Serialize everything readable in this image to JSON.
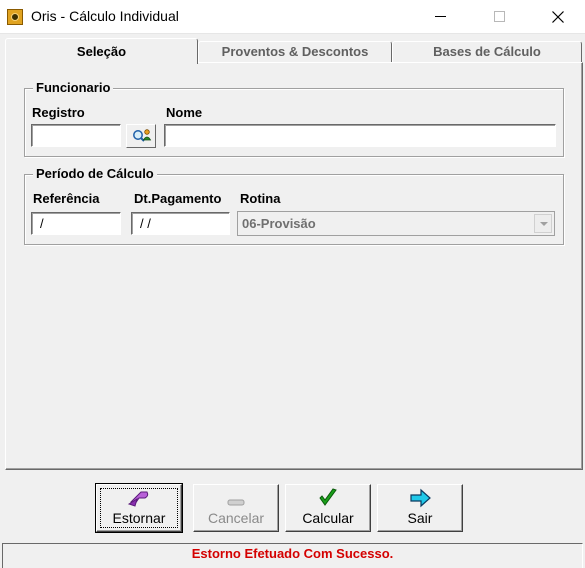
{
  "window": {
    "title": "Oris - Cálculo Individual",
    "icon": "oris-app-icon"
  },
  "tabs": [
    {
      "label": "Seleção",
      "selected": true
    },
    {
      "label": "Proventos & Descontos",
      "selected": false
    },
    {
      "label": "Bases de Cálculo",
      "selected": false
    }
  ],
  "funcionario": {
    "group_label": "Funcionario",
    "registro_label": "Registro",
    "registro_value": "",
    "nome_label": "Nome",
    "nome_value": "",
    "lookup_icon": "search-person-icon"
  },
  "periodo": {
    "group_label": "Período de Cálculo",
    "referencia_label": "Referência",
    "referencia_value": "/",
    "dt_pagamento_label": "Dt.Pagamento",
    "dt_pagamento_value": "/ /",
    "rotina_label": "Rotina",
    "rotina_value": "06-Provisão"
  },
  "buttons": {
    "estornar": "Estornar",
    "cancelar": "Cancelar",
    "calcular": "Calcular",
    "sair": "Sair"
  },
  "status": {
    "message": "Estorno Efetuado Com Sucesso.",
    "color": "#d40000"
  }
}
